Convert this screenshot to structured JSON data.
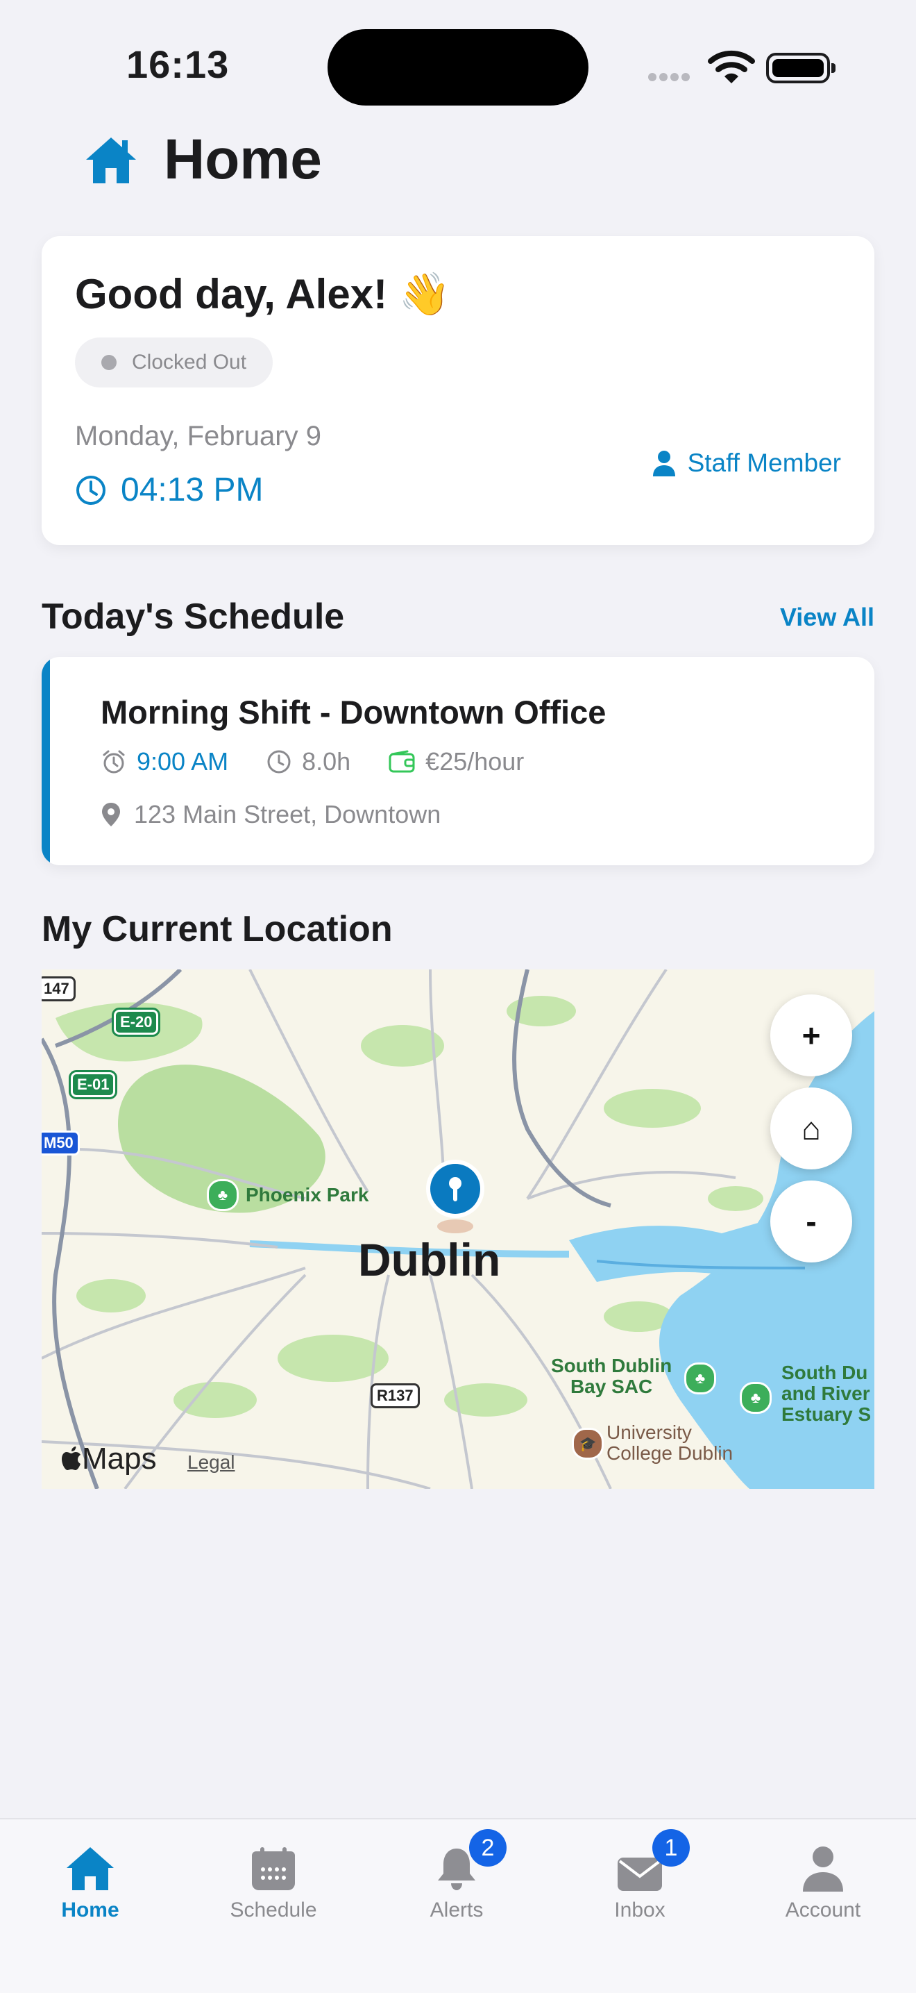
{
  "status_bar": {
    "time": "16:13"
  },
  "header": {
    "title": "Home"
  },
  "greeting_card": {
    "greeting": "Good day, Alex! 👋",
    "clock_status": "Clocked Out",
    "date": "Monday, February 9",
    "time": "04:13 PM",
    "role": "Staff Member"
  },
  "schedule": {
    "title": "Today's Schedule",
    "view_all": "View All",
    "shift": {
      "title": "Morning Shift - Downtown Office",
      "start_time": "9:00 AM",
      "duration": "8.0h",
      "rate": "€25/hour",
      "address": "123 Main Street, Downtown"
    }
  },
  "location": {
    "title": "My Current Location",
    "map": {
      "city_label": "Dublin",
      "place_labels": {
        "phoenix_park": "Phoenix Park",
        "south_dublin_bay_1": "South Dublin",
        "south_dublin_bay_2": "Bay SAC",
        "south_dublin_estuary_1": "South Du",
        "south_dublin_estuary_2": "and River",
        "south_dublin_estuary_3": "Estuary S",
        "ucd_1": "University",
        "ucd_2": "College Dublin"
      },
      "road_shields": {
        "r147": "147",
        "e20": "E-20",
        "e01": "E-01",
        "m50": "M50",
        "r137": "R137"
      },
      "controls": {
        "zoom_in": "+",
        "home": "⌂",
        "zoom_out": "-"
      },
      "brand": "Maps",
      "legal": "Legal"
    }
  },
  "tab_bar": {
    "tabs": [
      {
        "label": "Home",
        "icon": "house-icon",
        "active": true
      },
      {
        "label": "Schedule",
        "icon": "calendar-icon"
      },
      {
        "label": "Alerts",
        "icon": "bell-icon",
        "badge": "2"
      },
      {
        "label": "Inbox",
        "icon": "envelope-icon",
        "badge": "1"
      },
      {
        "label": "Account",
        "icon": "person-icon"
      }
    ]
  },
  "colors": {
    "accent": "#0a84c6",
    "badge": "#1464e6",
    "background": "#f2f2f7"
  }
}
